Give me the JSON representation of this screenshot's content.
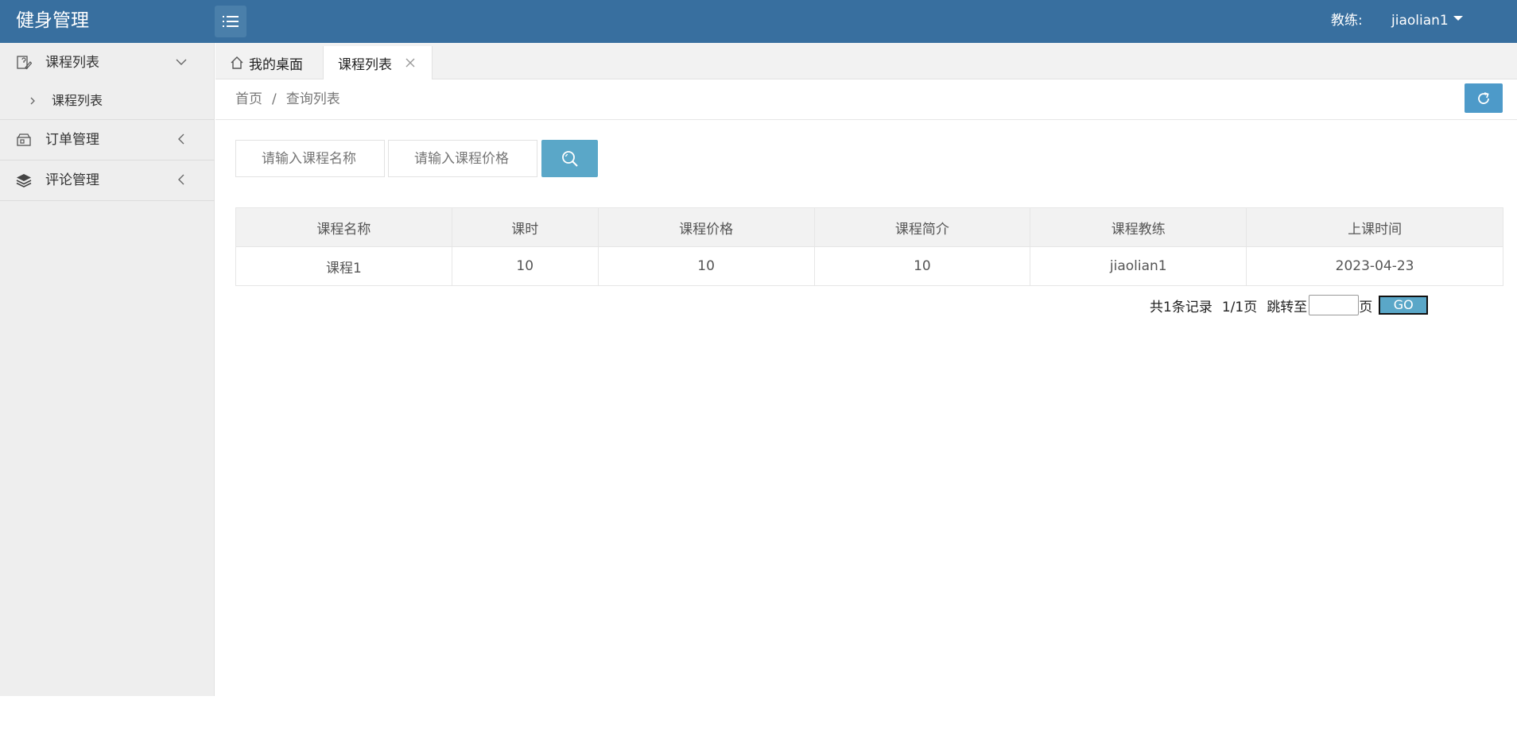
{
  "header": {
    "app_title": "健身管理",
    "role_label": "教练:",
    "username": "jiaolian1"
  },
  "sidebar": {
    "groups": [
      {
        "label": "课程列表",
        "icon": "edit-doc-icon",
        "expanded": true,
        "children": [
          {
            "label": "课程列表"
          }
        ]
      },
      {
        "label": "订单管理",
        "icon": "storefront-icon",
        "expanded": false,
        "children": []
      },
      {
        "label": "评论管理",
        "icon": "layers-icon",
        "expanded": false,
        "children": []
      }
    ]
  },
  "tabs": {
    "home_label": "我的桌面",
    "active_label": "课程列表"
  },
  "breadcrumb": {
    "home": "首页",
    "separator": "/",
    "current": "查询列表"
  },
  "search": {
    "name_placeholder": "请输入课程名称",
    "price_placeholder": "请输入课程价格"
  },
  "table": {
    "columns": [
      "课程名称",
      "课时",
      "课程价格",
      "课程简介",
      "课程教练",
      "上课时间"
    ],
    "rows": [
      [
        "课程1",
        "10",
        "10",
        "10",
        "jiaolian1",
        "2023-04-23"
      ]
    ]
  },
  "pagination": {
    "total_text": "共1条记录",
    "page_text": "1/1页",
    "jump_label": "跳转至",
    "page_unit": "页",
    "go_label": "GO"
  },
  "colors": {
    "header_bg": "#386f9f",
    "accent": "#5aa7c8",
    "sidebar_bg": "#eeeeee"
  }
}
